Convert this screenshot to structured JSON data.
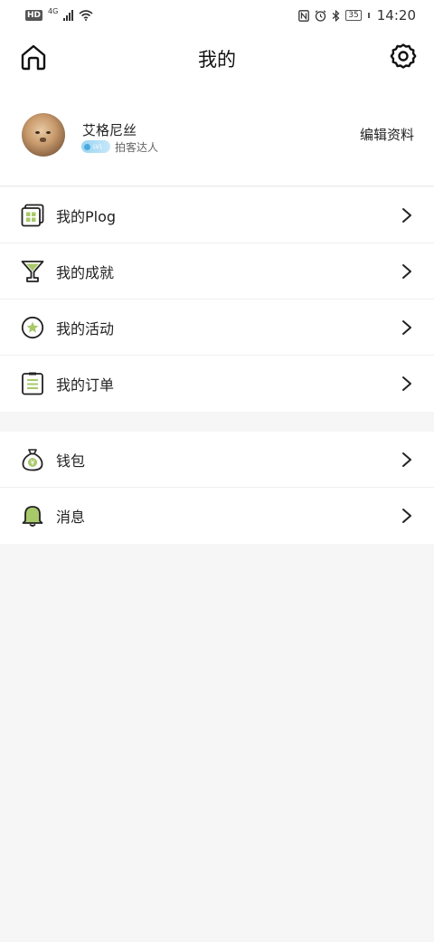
{
  "status_bar": {
    "hd": "HD",
    "network": "4G",
    "battery": "35",
    "time": "14:20"
  },
  "header": {
    "title": "我的"
  },
  "profile": {
    "username": "艾格尼丝",
    "level_badge": "LV1",
    "level_title": "拍客达人",
    "edit_label": "编辑资料"
  },
  "menu_groups": [
    [
      {
        "label": "我的Plog",
        "icon": "plog-icon"
      },
      {
        "label": "我的成就",
        "icon": "trophy-icon"
      },
      {
        "label": "我的活动",
        "icon": "star-badge-icon"
      },
      {
        "label": "我的订单",
        "icon": "order-list-icon"
      }
    ],
    [
      {
        "label": "钱包",
        "icon": "money-bag-icon"
      },
      {
        "label": "消息",
        "icon": "bell-icon"
      }
    ]
  ],
  "colors": {
    "accent_green": "#a8c96a",
    "background": "#f6f6f6"
  }
}
